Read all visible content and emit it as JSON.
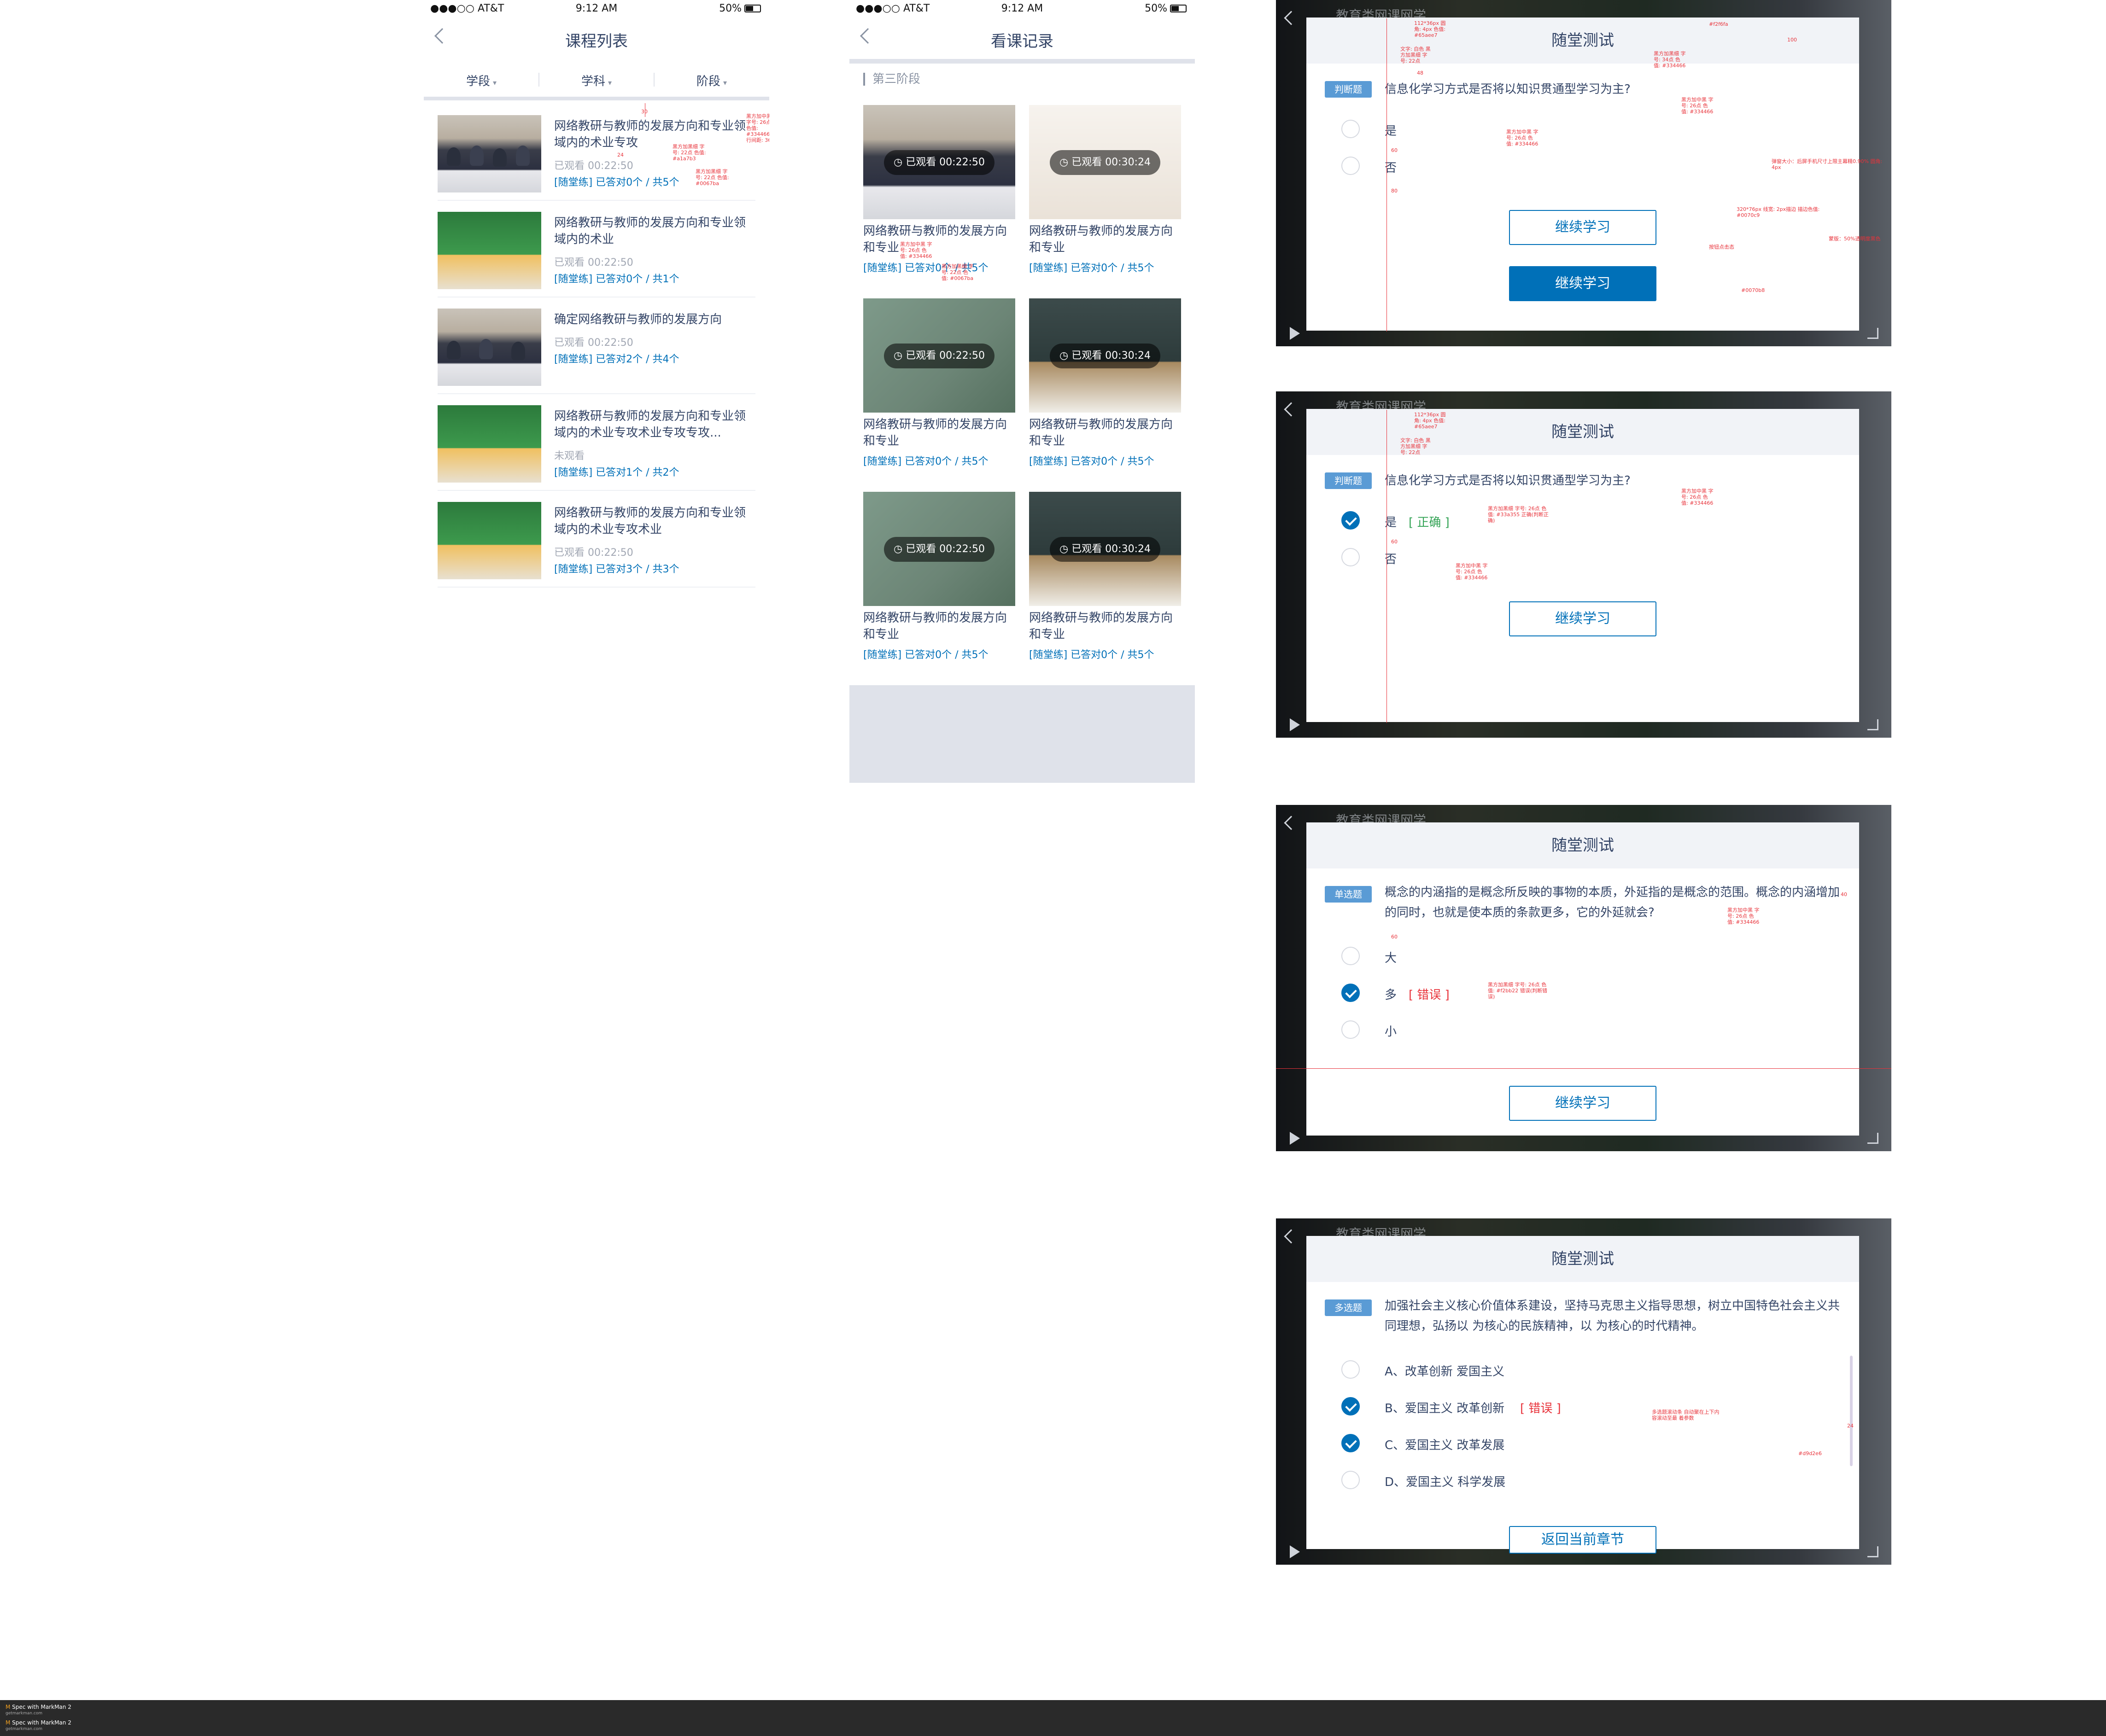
{
  "status_bar": {
    "carrier": "●●●○○ AT&T",
    "time": "9:12 AM",
    "battery": "50%"
  },
  "course_list": {
    "title": "课程列表",
    "filters": [
      "学段",
      "学科",
      "阶段"
    ],
    "items": [
      {
        "title": "网络教研与教师的发展方向和专业领域内的术业专攻",
        "status": "已观看 00:22:50",
        "practice": "[随堂练] 已答对0个 / 共5个"
      },
      {
        "title": "网络教研与教师的发展方向和专业领域内的术业",
        "status": "已观看 00:22:50",
        "practice": "[随堂练] 已答对0个 / 共1个"
      },
      {
        "title": "确定网络教研与教师的发展方向",
        "status": "已观看 00:22:50",
        "practice": "[随堂练] 已答对2个 / 共4个"
      },
      {
        "title": "网络教研与教师的发展方向和专业领域内的术业专攻术业专攻专攻...",
        "status": "未观看",
        "practice": "[随堂练] 已答对1个 / 共2个"
      },
      {
        "title": "网络教研与教师的发展方向和专业领域内的术业专攻术业",
        "status": "已观看 00:22:50",
        "practice": "[随堂练] 已答对3个 / 共3个"
      }
    ]
  },
  "watch_history": {
    "title": "看课记录",
    "section": "第三阶段",
    "cards": [
      {
        "badge": "已观看 00:22:50",
        "title": "网络教研与教师的发展方向和专业",
        "practice": "[随堂练] 已答对0个 / 共5个"
      },
      {
        "badge": "已观看 00:30:24",
        "title": "网络教研与教师的发展方向和专业",
        "practice": "[随堂练] 已答对0个 / 共5个"
      },
      {
        "badge": "已观看 00:22:50",
        "title": "网络教研与教师的发展方向和专业",
        "practice": "[随堂练] 已答对0个 / 共5个"
      },
      {
        "badge": "已观看 00:30:24",
        "title": "网络教研与教师的发展方向和专业",
        "practice": "[随堂练] 已答对0个 / 共5个"
      },
      {
        "badge": "已观看 00:22:50",
        "title": "网络教研与教师的发展方向和专业",
        "practice": "[随堂练] 已答对0个 / 共5个"
      },
      {
        "badge": "已观看 00:30:24",
        "title": "网络教研与教师的发展方向和专业",
        "practice": "[随堂练] 已答对0个 / 共5个"
      }
    ]
  },
  "quiz": {
    "header": "随堂测试",
    "bg_title": "教育类网课网学",
    "panel1": {
      "tag": "判断题",
      "question": "信息化学习方式是否将以知识贯通型学习为主?",
      "options": [
        "是",
        "否"
      ],
      "button_outline": "继续学习",
      "button_filled": "继续学习"
    },
    "panel2": {
      "tag": "判断题",
      "question": "信息化学习方式是否将以知识贯通型学习为主?",
      "options": [
        "是",
        "否"
      ],
      "judge": "[ 正确 ]",
      "button": "继续学习"
    },
    "panel3": {
      "tag": "单选题",
      "question": "概念的内涵指的是概念所反映的事物的本质，外延指的是概念的范围。概念的内涵增加的同时，也就是使本质的条款更多，它的外延就会?",
      "options": [
        "大",
        "多",
        "小"
      ],
      "judge": "[ 错误 ]",
      "button": "继续学习"
    },
    "panel4": {
      "tag": "多选题",
      "question": "加强社会主义核心价值体系建设，坚持马克思主义指导思想，树立中国特色社会主义共同理想，弘扬以 为核心的民族精神，以 为核心的时代精神。",
      "options": [
        "A、改革创新 爱国主义",
        "B、爱国主义 改革创新",
        "C、爱国主义 改革发展",
        "D、爱国主义 科学发展"
      ],
      "judge": "[ 错误 ]",
      "button": "返回当前章节"
    }
  },
  "annotations": {
    "a1": "黑方加中黑 字号: 26点 色值: #334466 行间距: 36",
    "a2": "黑方加黑细 字号: 22点 色值: #a1a7b3",
    "a3": "黑方加黑细 字号: 22点 色值: #0067ba",
    "a4": "黑方加中黑 字号: 26点 色值: #334466",
    "a5": "#0070b8",
    "a6": "#f2f6fa",
    "a7": "112*36px 圆角: 4px 色值: #65aee7",
    "a8": "文字: 白色 黑方加黑细 字号: 22点",
    "a9": "黑方加黑细 字号: 34点 色值: #334466",
    "a10": "320*76px 线宽: 2px描边 描边色值: #0070c9",
    "a11": "按钮点击态",
    "a12": "弹窗大小：后屏手机尺寸上限主幕精0.90%  圆角: 4px",
    "a13": "蒙版：50%透明度黑色",
    "a14": "黑方加黑细 字号: 26点 色值: #33a355 正确(判断正确)",
    "a15": "黑方加黑细 字号: 26点 色值: #f2bb22 错误(判断错误)",
    "a16": "多选题滚动条 自动聚在上下内容滚动至最 着参数",
    "a17": "#d9d2e6",
    "a18": "50",
    "a19": "48",
    "a20": "60",
    "a21": "40",
    "a22": "30",
    "a23": "100",
    "a24": "24",
    "a25": "80",
    "footer": [
      "Spec with MarkMan 2",
      "getmarkman.com",
      "Spec with MarkMan 2",
      "getmarkman.com"
    ]
  }
}
